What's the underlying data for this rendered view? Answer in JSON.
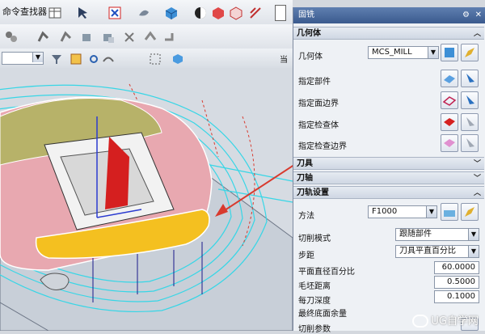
{
  "toolbar": {
    "command_finder": "命令查找器",
    "right_header_char": "当"
  },
  "dialog": {
    "title": "固铣",
    "geometry_section": "几何体",
    "geometry_label": "几何体",
    "geometry_value": "MCS_MILL",
    "specify_part": "指定部件",
    "specify_face_boundary": "指定面边界",
    "specify_check_body": "指定检查体",
    "specify_check_boundary": "指定检查边界",
    "tool_section": "刀具",
    "axis_section": "刀轴",
    "path_section": "刀轨设置",
    "method_label": "方法",
    "method_value": "F1000",
    "cut_mode_label": "切削模式",
    "cut_mode_value": "跟随部件",
    "stepover_label": "步距",
    "stepover_value": "刀具平直百分比",
    "tool_pct_label": "平面直径百分比",
    "tool_pct_value": "60.0000",
    "blank_dist_label": "毛坯距离",
    "blank_dist_value": "0.5000",
    "depth_per_cut_label": "每刀深度",
    "depth_per_cut_value": "0.1000",
    "floor_stock_label": "最终底面余量",
    "cut_levels_label": "切削参数"
  },
  "watermark": "UG自学网",
  "colors": {
    "title_bar": "#4a6a9e",
    "part_pink": "#e8a8b0",
    "yellow_region": "#f4c020",
    "toolpath_cyan": "#37d6e6",
    "arrow_red": "#d83a2e"
  }
}
